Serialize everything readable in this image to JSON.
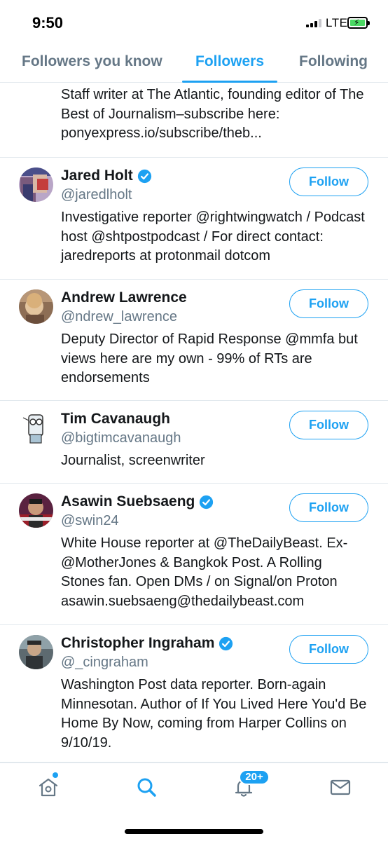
{
  "status_bar": {
    "time": "9:50",
    "network": "LTE"
  },
  "tabs": [
    {
      "label": "Followers you know",
      "active": false
    },
    {
      "label": "Followers",
      "active": true
    },
    {
      "label": "Following",
      "active": false
    }
  ],
  "accent_color": "#1da1f2",
  "partial_bio": "Staff writer at The Atlantic, founding editor of The Best of Journalism–subscribe here: ponyexpress.io/subscribe/theb...",
  "users": [
    {
      "name": "Jared Holt",
      "handle": "@jaredlholt",
      "verified": true,
      "button": "Follow",
      "bio": "Investigative reporter @rightwingwatch / Podcast host @shtpostpodcast / For direct contact: jaredreports at protonmail dotcom"
    },
    {
      "name": "Andrew Lawrence",
      "handle": "@ndrew_lawrence",
      "verified": false,
      "button": "Follow",
      "bio": "Deputy Director of Rapid Response @mmfa but views here are my own - 99% of RTs are endorsements"
    },
    {
      "name": "Tim Cavanaugh",
      "handle": "@bigtimcavanaugh",
      "verified": false,
      "button": "Follow",
      "bio": "Journalist, screenwriter"
    },
    {
      "name": "Asawin Suebsaeng",
      "handle": "@swin24",
      "verified": true,
      "button": "Follow",
      "bio": "White House reporter at @TheDailyBeast. Ex- @MotherJones & Bangkok Post. A Rolling Stones fan. Open DMs / on Signal/on Proton asawin.suebsaeng@thedailybeast.com"
    },
    {
      "name": "Christopher Ingraham",
      "handle": "@_cingraham",
      "verified": true,
      "button": "Follow",
      "bio": "Washington Post data reporter. Born-again Minnesotan. Author of If You Lived Here You'd Be Home By Now, coming from Harper Collins on 9/10/19."
    }
  ],
  "bottom_nav": {
    "items": [
      "home-icon",
      "search-icon",
      "notifications-icon",
      "messages-icon"
    ],
    "notification_badge": "20+"
  }
}
